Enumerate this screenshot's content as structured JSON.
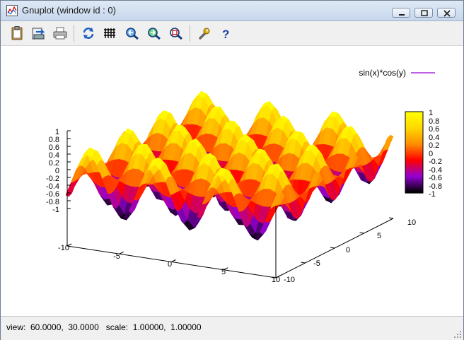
{
  "window": {
    "title": "Gnuplot (window id : 0)",
    "caption_buttons": [
      "minimize",
      "restore",
      "close"
    ]
  },
  "toolbar": {
    "buttons": [
      {
        "name": "copy-clipboard",
        "icon": "clipboard-icon"
      },
      {
        "name": "print-to-file",
        "icon": "export-icon"
      },
      {
        "name": "print",
        "icon": "printer-icon"
      },
      {
        "name": "replot",
        "icon": "refresh-icon"
      },
      {
        "name": "grid",
        "icon": "grid-icon"
      },
      {
        "name": "zoom-previous",
        "icon": "zoom-back-icon"
      },
      {
        "name": "zoom-next",
        "icon": "zoom-forward-icon"
      },
      {
        "name": "autoscale",
        "icon": "zoom-fit-icon"
      },
      {
        "name": "options",
        "icon": "wrench-icon"
      },
      {
        "name": "help",
        "icon": "help-icon"
      }
    ]
  },
  "plot": {
    "legend": {
      "label": "sin(x)*cos(y)",
      "color": "#9400d3"
    },
    "z_ticks": [
      "1",
      "0.8",
      "0.6",
      "0.4",
      "0.2",
      "0",
      "-0.2",
      "-0.4",
      "-0.6",
      "-0.8",
      "-1"
    ],
    "x_ticks": [
      "-10",
      "-5",
      "0",
      "5",
      "10"
    ],
    "y_ticks": [
      "10",
      "5",
      "0",
      "-5",
      "-10"
    ],
    "colorbox_ticks": [
      "1",
      "0.8",
      "0.6",
      "0.4",
      "0.2",
      "0",
      "-0.2",
      "-0.4",
      "-0.6",
      "-0.8",
      "-1"
    ],
    "palette": [
      "#000000",
      "#9400d3",
      "#ff0000",
      "#ff8c00",
      "#ffd700",
      "#ffff00"
    ]
  },
  "status": {
    "text": "view:  60.0000,  30.0000   scale:  1.00000,  1.00000"
  }
}
